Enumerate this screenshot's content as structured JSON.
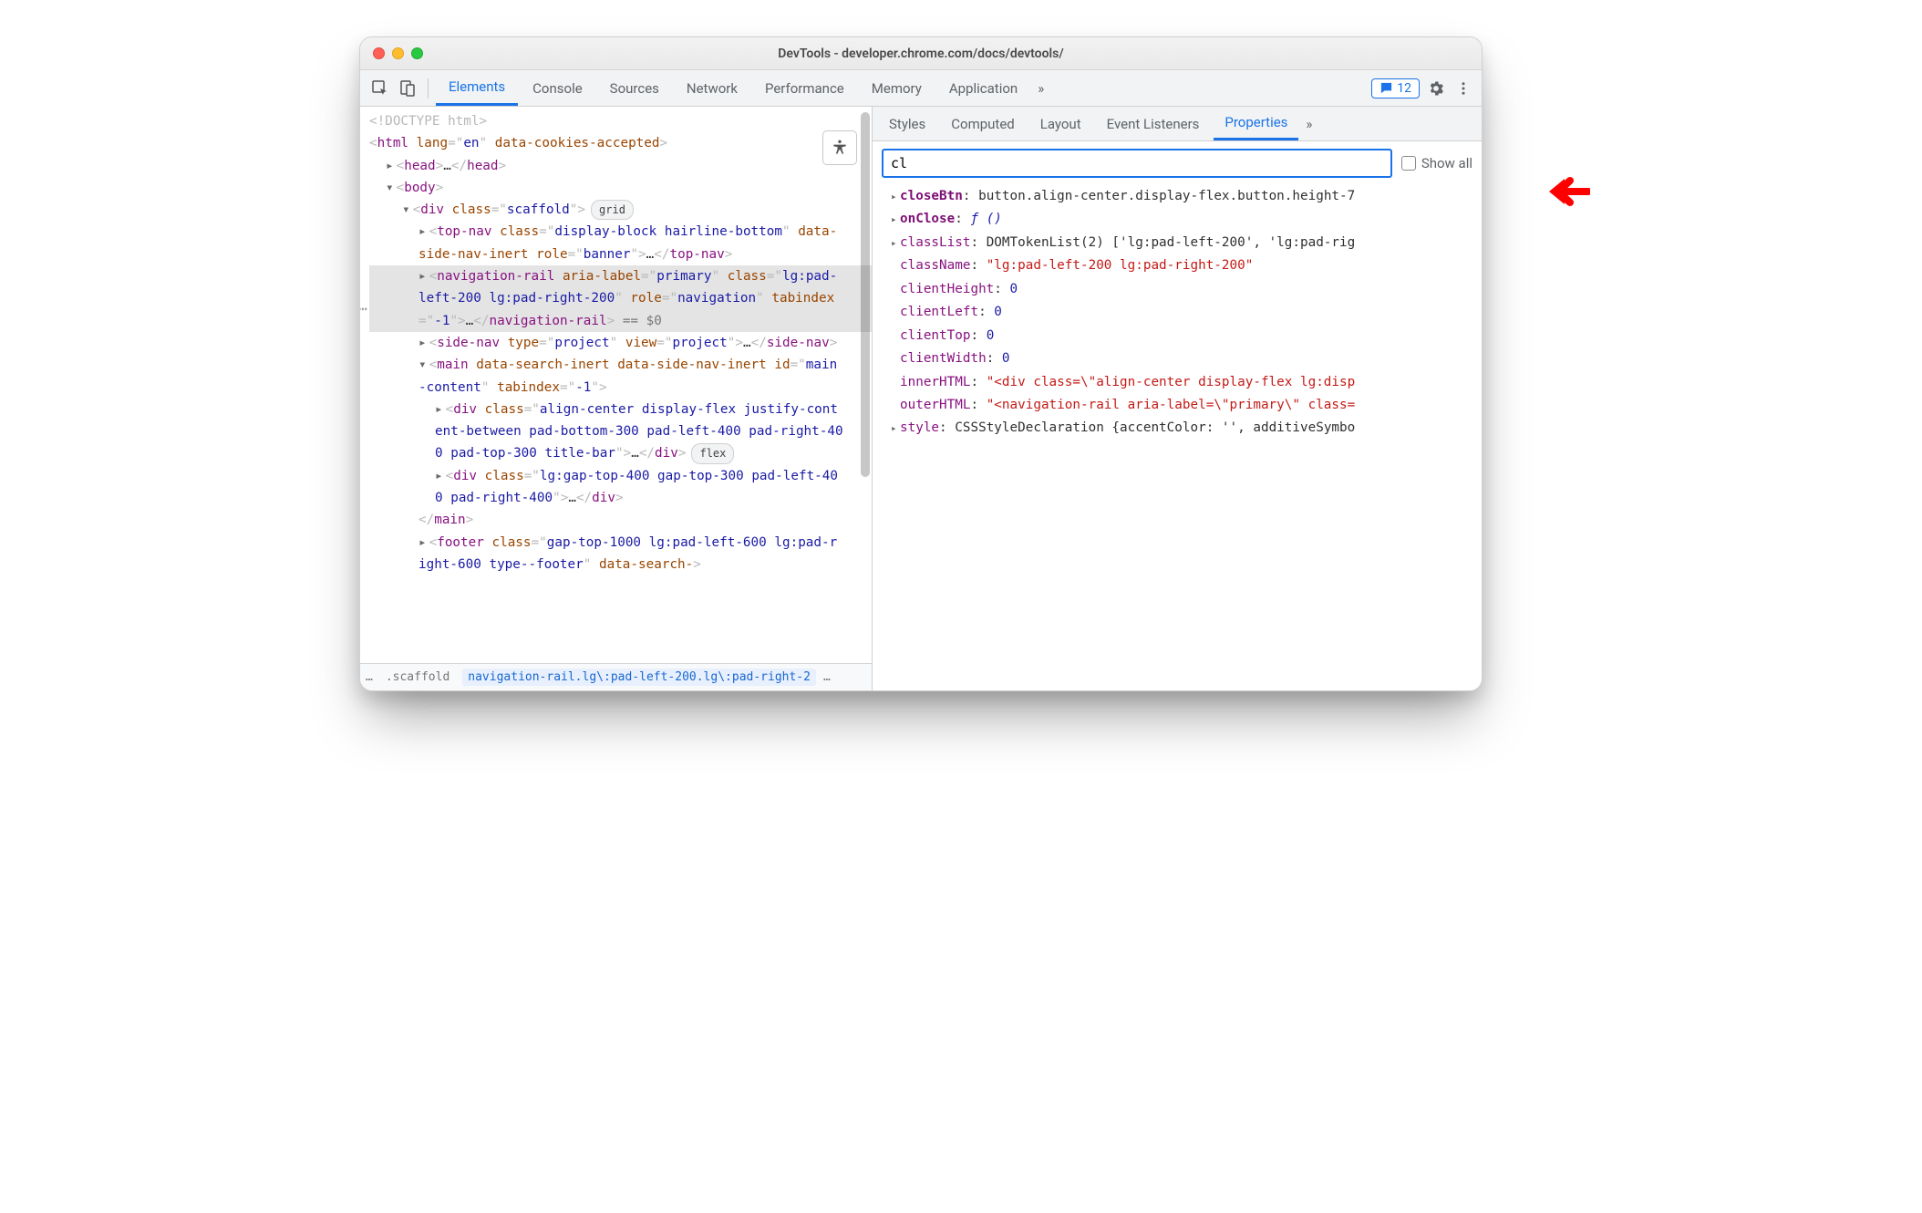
{
  "window": {
    "title": "DevTools - developer.chrome.com/docs/devtools/"
  },
  "tabs": {
    "items": [
      "Elements",
      "Console",
      "Sources",
      "Network",
      "Performance",
      "Memory",
      "Application"
    ],
    "active": "Elements",
    "overflow_glyph": "»",
    "issues_count": "12"
  },
  "a11y_button_title": "Accessibility",
  "dom": {
    "doctype": "<!DOCTYPE html>",
    "html_open": {
      "tag": "html",
      "attrs": [
        {
          "n": "lang",
          "v": "en"
        },
        {
          "n": "data-cookies-accepted",
          "v": null
        }
      ]
    },
    "head": "<head>…</head>",
    "body_open": "<body>",
    "scaffold": {
      "tag": "div",
      "attrs": [
        {
          "n": "class",
          "v": "scaffold"
        }
      ],
      "badge": "grid"
    },
    "topnav": {
      "tag": "top-nav",
      "attrs": [
        {
          "n": "class",
          "v": "display-block hairline-bottom"
        },
        {
          "n": "data-side-nav-inert",
          "v": null
        },
        {
          "n": "role",
          "v": "banner"
        }
      ]
    },
    "navrail": {
      "tag": "navigation-rail",
      "attrs": [
        {
          "n": "aria-label",
          "v": "primary"
        },
        {
          "n": "class",
          "v": "lg:pad-left-200 lg:pad-right-200"
        },
        {
          "n": "role",
          "v": "navigation"
        },
        {
          "n": "tabindex",
          "v": "-1"
        }
      ],
      "eqtext": "== $0"
    },
    "sidenav": {
      "tag": "side-nav",
      "attrs": [
        {
          "n": "type",
          "v": "project"
        },
        {
          "n": "view",
          "v": "project"
        }
      ]
    },
    "main": {
      "tag": "main",
      "attrs": [
        {
          "n": "data-search-inert",
          "v": null
        },
        {
          "n": "data-side-nav-inert",
          "v": null
        },
        {
          "n": "id",
          "v": "main-content"
        },
        {
          "n": "tabindex",
          "v": "-1"
        }
      ]
    },
    "titlebar_div": {
      "tag": "div",
      "attrs": [
        {
          "n": "class",
          "v": "align-center display-flex justify-content-between pad-bottom-300 pad-left-400 pad-right-400 pad-top-300 title-bar"
        }
      ],
      "badge": "flex"
    },
    "content_div": {
      "tag": "div",
      "attrs": [
        {
          "n": "class",
          "v": "lg:gap-top-400 gap-top-300 pad-left-400 pad-right-400"
        }
      ]
    },
    "main_close": "</main>",
    "footer": {
      "tag": "footer",
      "attrs": [
        {
          "n": "class",
          "v": "gap-top-1000 lg:pad-left-600 lg:pad-right-600 type--footer"
        },
        {
          "n": "data-search-",
          "v": null
        }
      ]
    }
  },
  "crumbs": {
    "leading": "…",
    "scaffold": ".scaffold",
    "active": "navigation-rail.lg\\:pad-left-200.lg\\:pad-right-2",
    "trailing": "…"
  },
  "sidebar": {
    "tabs": [
      "Styles",
      "Computed",
      "Layout",
      "Event Listeners",
      "Properties"
    ],
    "active": "Properties",
    "overflow_glyph": "»",
    "filter_value": "cl",
    "show_all_label": "Show all"
  },
  "props": [
    {
      "expand": true,
      "name": "closeBtn",
      "bold": true,
      "kind": "obj",
      "value": "button.align-center.display-flex.button.height-7"
    },
    {
      "expand": true,
      "name": "onClose",
      "bold": true,
      "kind": "fn",
      "value": "ƒ ()"
    },
    {
      "expand": true,
      "name": "classList",
      "bold": false,
      "kind": "obj",
      "value": "DOMTokenList(2) ['lg:pad-left-200', 'lg:pad-rig"
    },
    {
      "expand": false,
      "name": "className",
      "bold": false,
      "kind": "str",
      "value": "\"lg:pad-left-200 lg:pad-right-200\""
    },
    {
      "expand": false,
      "name": "clientHeight",
      "bold": false,
      "kind": "num",
      "value": "0"
    },
    {
      "expand": false,
      "name": "clientLeft",
      "bold": false,
      "kind": "num",
      "value": "0"
    },
    {
      "expand": false,
      "name": "clientTop",
      "bold": false,
      "kind": "num",
      "value": "0"
    },
    {
      "expand": false,
      "name": "clientWidth",
      "bold": false,
      "kind": "num",
      "value": "0"
    },
    {
      "expand": false,
      "name": "innerHTML",
      "bold": false,
      "kind": "str",
      "value": "\"<div class=\\\"align-center display-flex lg:disp"
    },
    {
      "expand": false,
      "name": "outerHTML",
      "bold": false,
      "kind": "str",
      "value": "\"<navigation-rail aria-label=\\\"primary\\\" class="
    },
    {
      "expand": true,
      "name": "style",
      "bold": false,
      "kind": "obj",
      "value": "CSSStyleDeclaration {accentColor: '', additiveSymbo"
    }
  ]
}
